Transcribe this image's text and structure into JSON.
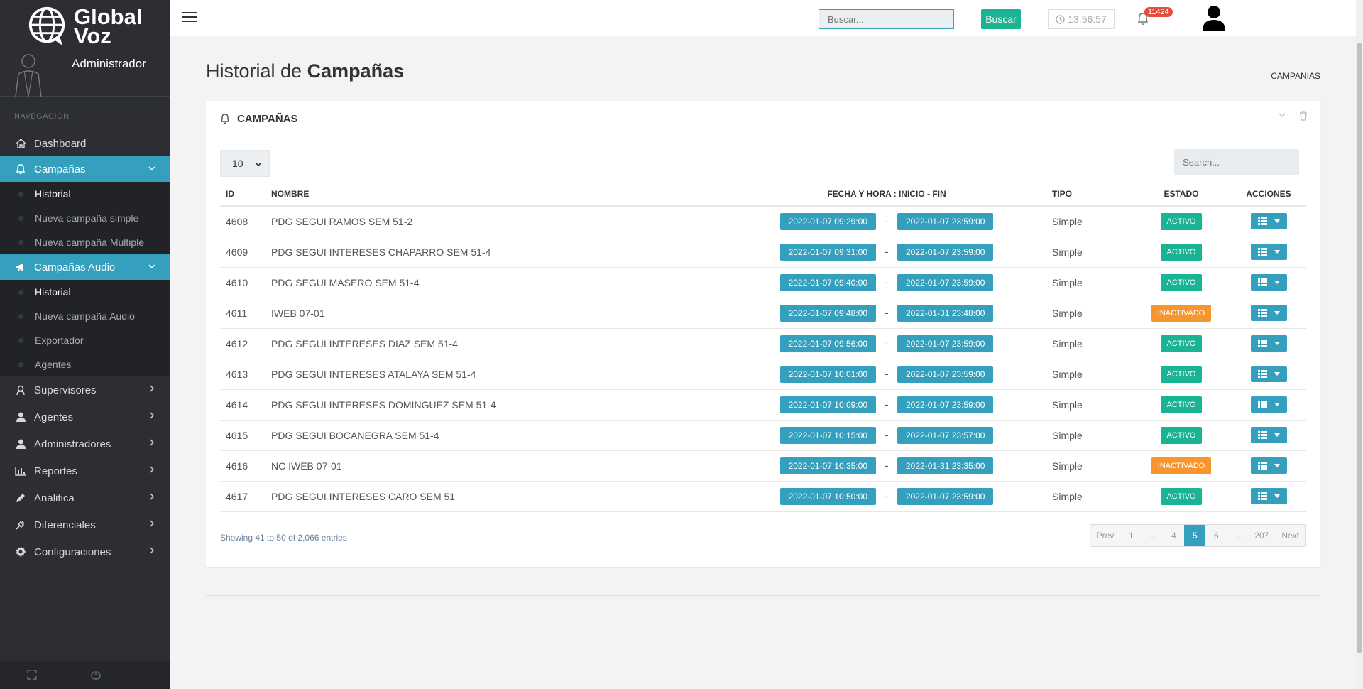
{
  "brand": {
    "line1": "Global",
    "line2": "Voz"
  },
  "user_role": "Administrador",
  "nav_title": "NAVEGACIÓN",
  "nav": {
    "dashboard": "Dashboard",
    "campanas": "Campañas",
    "campanas_sub": [
      "Historial",
      "Nueva campaña simple",
      "Nueva campaña Multiple"
    ],
    "audio": "Campañas Audio",
    "audio_sub": [
      "Historial",
      "Nueva campaña Audio",
      "Exportador",
      "Agentes"
    ],
    "supervisores": "Supervisores",
    "agentes": "Agentes",
    "administradores": "Administradores",
    "reportes": "Reportes",
    "analitica": "Analitica",
    "diferenciales": "Diferenciales",
    "configuraciones": "Configuraciones"
  },
  "topbar": {
    "search_placeholder": "Buscar...",
    "search_button": "Buscar",
    "clock": "13:56:57",
    "notif_count": "11424"
  },
  "page": {
    "title_light": "Historial de",
    "title_bold": "Campañas",
    "breadcrumb": "CAMPANIAS"
  },
  "card": {
    "title": "CAMPAÑAS",
    "page_length": "10",
    "search_placeholder": "Search...",
    "columns": {
      "id": "ID",
      "nombre": "NOMBRE",
      "fecha": "FECHA Y HORA : INICIO - FIN",
      "tipo": "TIPO",
      "estado": "ESTADO",
      "acciones": "ACCIONES"
    },
    "rows": [
      {
        "id": "4608",
        "nombre": "PDG SEGUI RAMOS SEM 51-2",
        "inicio": "2022-01-07 09:29:00",
        "sep": "-",
        "fin": "2022-01-07 23:59:00",
        "tipo": "Simple",
        "estado": "ACTIVO"
      },
      {
        "id": "4609",
        "nombre": "PDG SEGUI INTERESES CHAPARRO SEM 51-4",
        "inicio": "2022-01-07 09:31:00",
        "sep": "-",
        "fin": "2022-01-07 23:59:00",
        "tipo": "Simple",
        "estado": "ACTIVO"
      },
      {
        "id": "4610",
        "nombre": "PDG SEGUI MASERO SEM 51-4",
        "inicio": "2022-01-07 09:40:00",
        "sep": "-",
        "fin": "2022-01-07 23:59:00",
        "tipo": "Simple",
        "estado": "ACTIVO"
      },
      {
        "id": "4611",
        "nombre": "IWEB 07-01",
        "inicio": "2022-01-07 09:48:00",
        "sep": "-",
        "fin": "2022-01-31 23:48:00",
        "tipo": "Simple",
        "estado": "INACTIVADO"
      },
      {
        "id": "4612",
        "nombre": "PDG SEGUI INTERESES DIAZ SEM 51-4",
        "inicio": "2022-01-07 09:56:00",
        "sep": "-",
        "fin": "2022-01-07 23:59:00",
        "tipo": "Simple",
        "estado": "ACTIVO"
      },
      {
        "id": "4613",
        "nombre": "PDG SEGUI INTERESES ATALAYA SEM 51-4",
        "inicio": "2022-01-07 10:01:00",
        "sep": "-",
        "fin": "2022-01-07 23:59:00",
        "tipo": "Simple",
        "estado": "ACTIVO"
      },
      {
        "id": "4614",
        "nombre": "PDG SEGUI INTERESES DOMINGUEZ SEM 51-4",
        "inicio": "2022-01-07 10:09:00",
        "sep": "-",
        "fin": "2022-01-07 23:59:00",
        "tipo": "Simple",
        "estado": "ACTIVO"
      },
      {
        "id": "4615",
        "nombre": "PDG SEGUI BOCANEGRA SEM 51-4",
        "inicio": "2022-01-07 10:15:00",
        "sep": "-",
        "fin": "2022-01-07 23:57:00",
        "tipo": "Simple",
        "estado": "ACTIVO"
      },
      {
        "id": "4616",
        "nombre": "NC IWEB 07-01",
        "inicio": "2022-01-07 10:35:00",
        "sep": "-",
        "fin": "2022-01-31 23:35:00",
        "tipo": "Simple",
        "estado": "INACTIVADO"
      },
      {
        "id": "4617",
        "nombre": "PDG SEGUI INTERESES CARO SEM 51",
        "inicio": "2022-01-07 10:50:00",
        "sep": "-",
        "fin": "2022-01-07 23:59:00",
        "tipo": "Simple",
        "estado": "ACTIVO"
      }
    ],
    "info": "Showing 41 to 50 of 2,066 entries",
    "pagination": [
      "Prev",
      "1",
      "...",
      "4",
      "5",
      "6",
      "...",
      "207",
      "Next"
    ],
    "current_page": "5"
  },
  "colors": {
    "accent": "#35a0bd",
    "green": "#1ab394",
    "orange": "#f8962e",
    "sidebar": "#2c2e32"
  }
}
